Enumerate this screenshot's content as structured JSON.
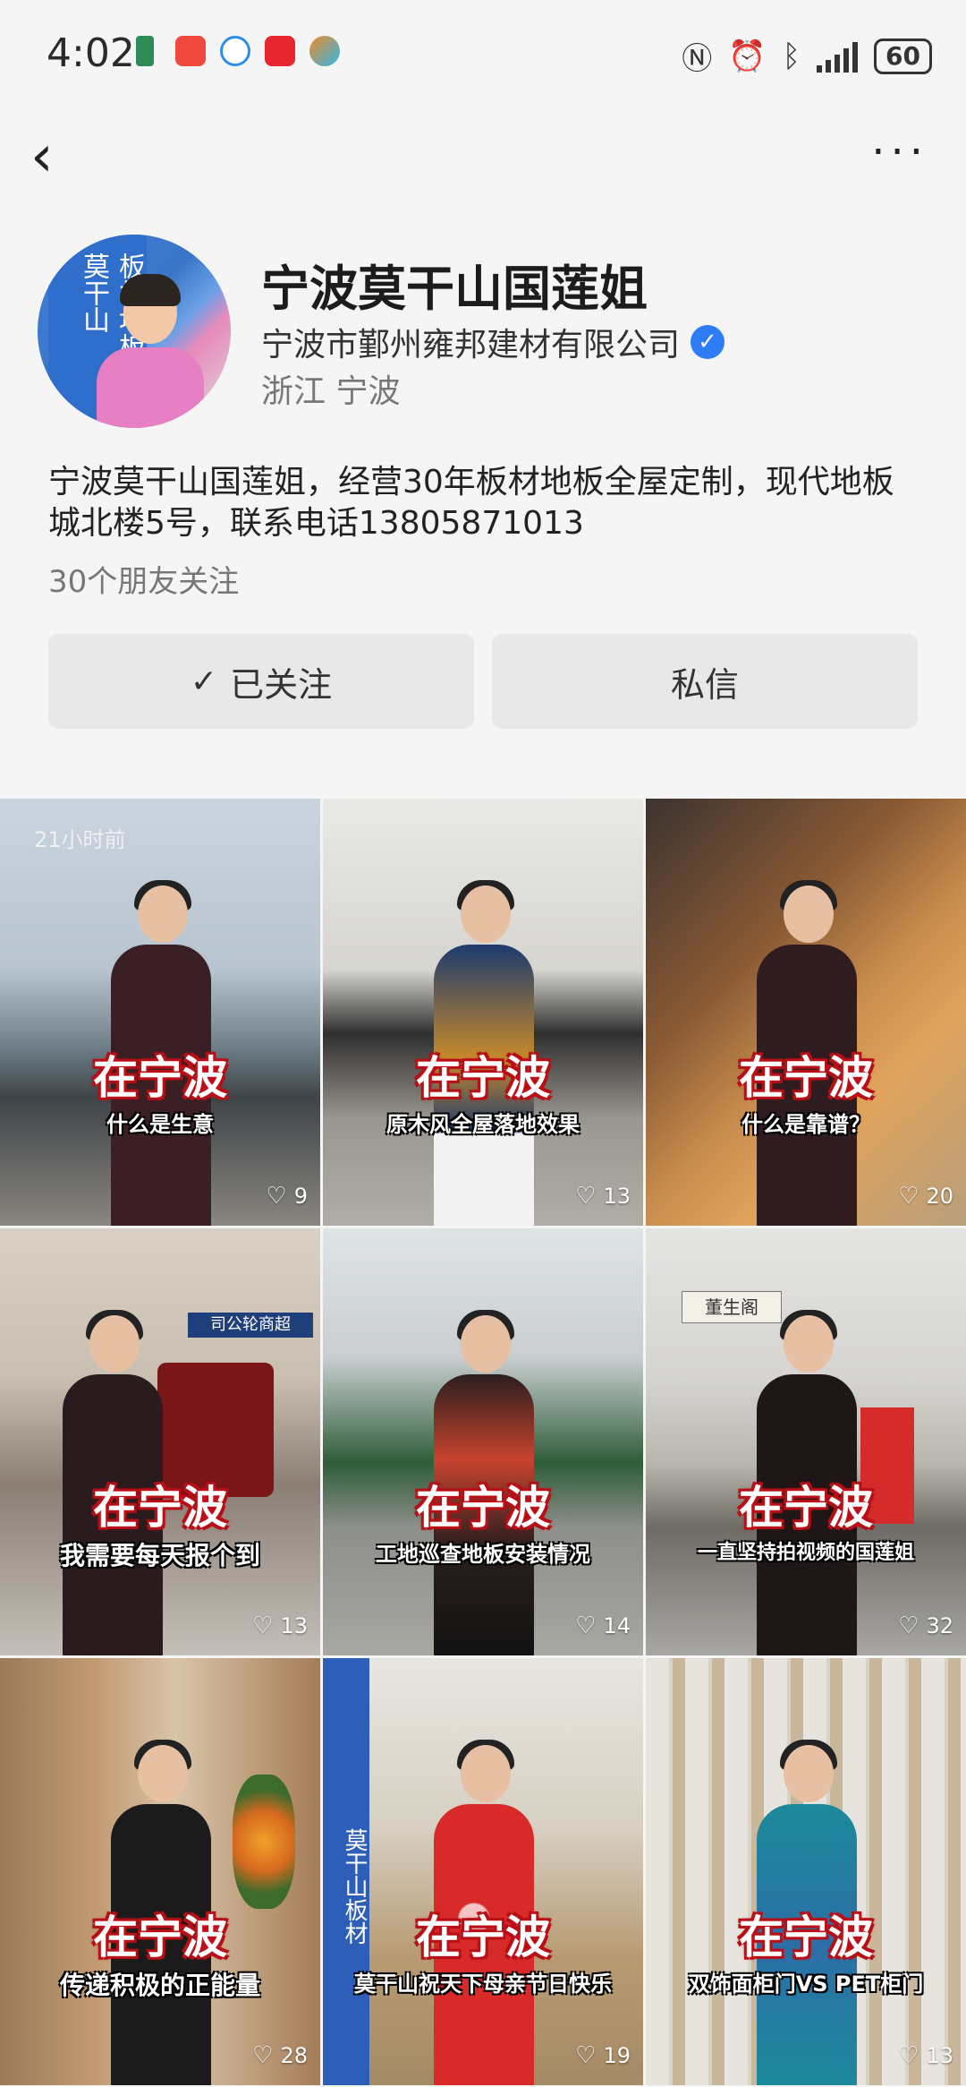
{
  "status_bar": {
    "time": "4:02",
    "battery": "60",
    "icons": [
      "nfc-icon",
      "alarm-icon",
      "bluetooth-icon",
      "signal-icon"
    ]
  },
  "nav": {
    "back_icon": "chevron-left-icon",
    "more_icon": "more-dots-icon"
  },
  "profile": {
    "avatar_text": "板材地板 宁波莫干山",
    "name": "宁波莫干山国莲姐",
    "company": "宁波市鄞州雍邦建材有限公司",
    "location": "浙江 宁波",
    "bio": "宁波莫干山国莲姐，经营30年板材地板全屋定制，现代地板城北楼5号，联系电话13805871013",
    "friends_following": "30个朋友关注"
  },
  "actions": {
    "follow_label": "已关注",
    "message_label": "私信"
  },
  "videos": [
    {
      "title": "在宁波",
      "subtitle": "什么是生意",
      "likes": "9",
      "time": "21小时前"
    },
    {
      "title": "在宁波",
      "subtitle": "原木风全屋落地效果",
      "likes": "13"
    },
    {
      "title": "在宁波",
      "subtitle": "什么是靠谱？",
      "likes": "20"
    },
    {
      "title": "在宁波",
      "subtitle": "我需要每天报个到",
      "likes": "13",
      "sign": "司公轮商超"
    },
    {
      "title": "在宁波",
      "subtitle": "工地巡查地板安装情况",
      "likes": "14"
    },
    {
      "title": "在宁波",
      "subtitle": "一直坚持拍视频的国莲姐",
      "likes": "32",
      "sign": "董生阁"
    },
    {
      "title": "在宁波",
      "subtitle": "传递积极的正能量",
      "likes": "28"
    },
    {
      "title": "在宁波",
      "subtitle": "莫干山祝天下母亲节日快乐",
      "likes": "19",
      "sign": "莫干山板材"
    },
    {
      "title": "在宁波",
      "subtitle": "双饰面柜门VS PET柜门",
      "likes": "13"
    }
  ],
  "colors": {
    "verified": "#2e7cf6",
    "title_stroke": "#b30f16"
  }
}
